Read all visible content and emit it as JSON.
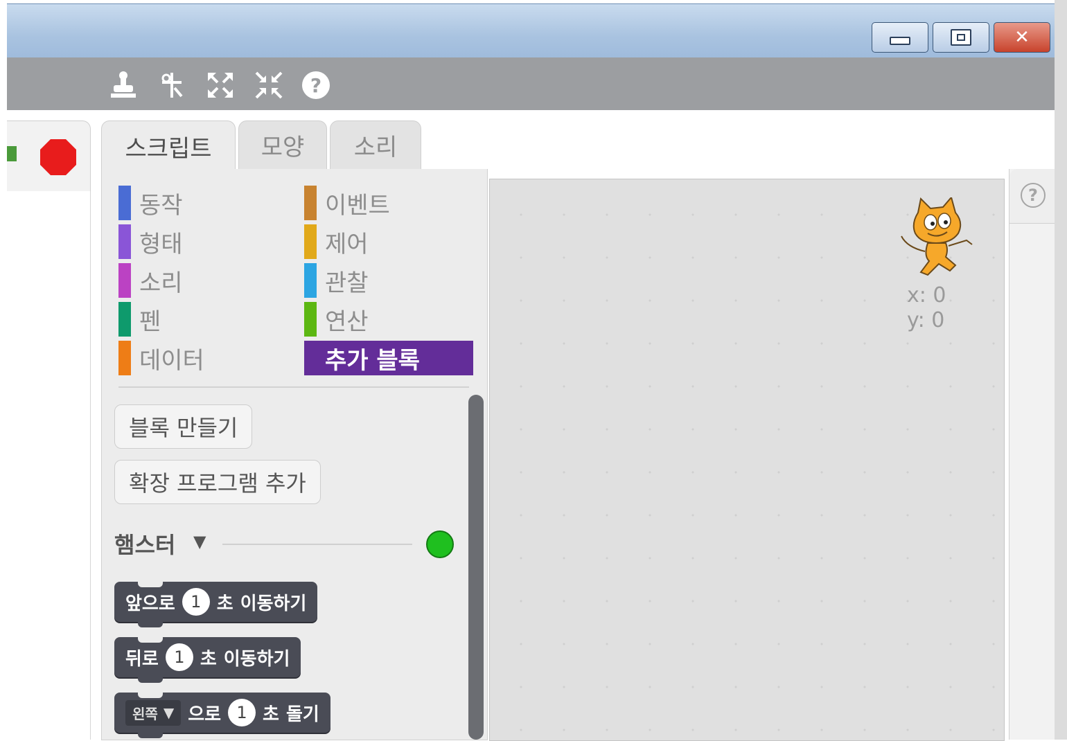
{
  "window": {
    "close_glyph": "✕"
  },
  "toolbar": {
    "tools": [
      "stamp-icon",
      "cut-icon",
      "grow-icon",
      "shrink-icon",
      "help-icon"
    ]
  },
  "tabs": [
    {
      "label": "스크립트",
      "active": true
    },
    {
      "label": "모양",
      "active": false
    },
    {
      "label": "소리",
      "active": false
    }
  ],
  "categories": {
    "left": [
      {
        "label": "동작",
        "color": "#4a6cd4"
      },
      {
        "label": "형태",
        "color": "#8a55d7"
      },
      {
        "label": "소리",
        "color": "#bb42c3"
      },
      {
        "label": "펜",
        "color": "#0e9a6c"
      },
      {
        "label": "데이터",
        "color": "#ee7d16"
      }
    ],
    "right": [
      {
        "label": "이벤트",
        "color": "#c88330"
      },
      {
        "label": "제어",
        "color": "#e1a91a"
      },
      {
        "label": "관찰",
        "color": "#2ca5e2"
      },
      {
        "label": "연산",
        "color": "#5cb712"
      },
      {
        "label": "추가 블록",
        "color": "#632d99",
        "selected": true
      }
    ]
  },
  "buttons": {
    "make_block": "블록 만들기",
    "add_extension": "확장 프로그램 추가"
  },
  "extension": {
    "name": "햄스터",
    "caret": "▼",
    "status_color": "#1fbf1f"
  },
  "blocks": [
    {
      "prefix": "앞으로",
      "value": "1",
      "unit": "초",
      "action": "이동하기"
    },
    {
      "prefix": "뒤로",
      "value": "1",
      "unit": "초",
      "action": "이동하기"
    },
    {
      "dropdown": "왼쪽",
      "dropdown_caret": "▼",
      "prefix": "으로",
      "value": "1",
      "unit": "초",
      "action": "돌기"
    }
  ],
  "sprite_info": {
    "x_label": "x:",
    "x_value": "0",
    "y_label": "y:",
    "y_value": "0"
  },
  "help": {
    "glyph": "?"
  }
}
